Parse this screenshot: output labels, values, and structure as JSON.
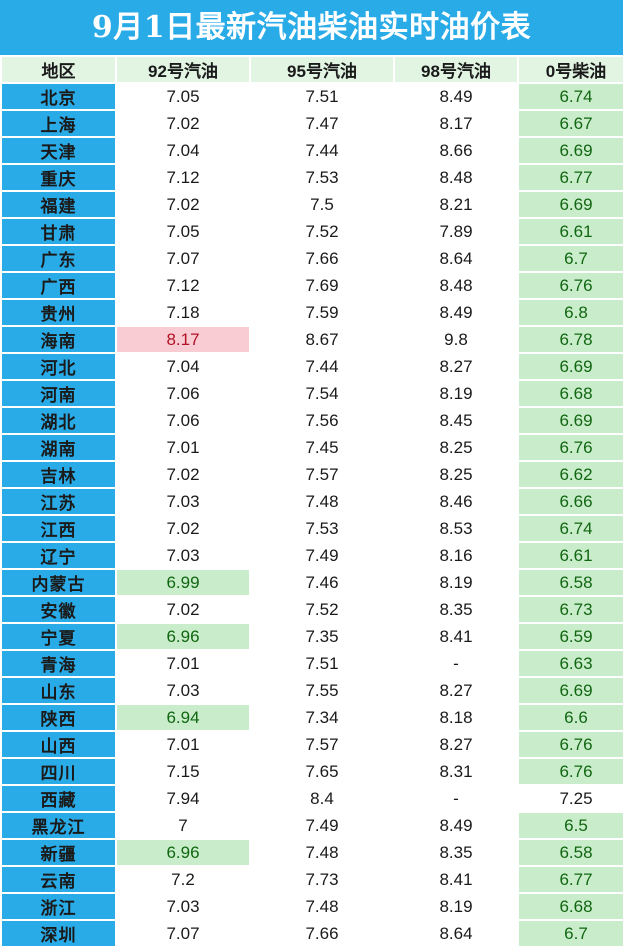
{
  "header": {
    "title": "9月1日最新汽油柴油实时油价表",
    "bar_color": "#29ABE8",
    "title_color": "#ffffff"
  },
  "table": {
    "columns": [
      {
        "key": "region",
        "label": "地区"
      },
      {
        "key": "g92",
        "label": "92号汽油"
      },
      {
        "key": "g95",
        "label": "95号汽油"
      },
      {
        "key": "g98",
        "label": "98号汽油"
      },
      {
        "key": "d0",
        "label": "0号柴油"
      }
    ],
    "colors": {
      "header_bg": "#E2F5E3",
      "region_bg": "#29ABE8",
      "region_text": "#ffffff",
      "cell_bg": "#ffffff",
      "highlight_low_bg": "#C9EDCB",
      "highlight_low_text": "#116611",
      "highlight_high_bg": "#F9CBD2",
      "highlight_high_text": "#B11226"
    },
    "rows": [
      {
        "region": "北京",
        "g92": "7.05",
        "g92_hl": "none",
        "g95": "7.51",
        "g95_hl": "none",
        "g98": "8.49",
        "g98_hl": "none",
        "d0": "6.74",
        "d0_hl": "low"
      },
      {
        "region": "上海",
        "g92": "7.02",
        "g92_hl": "none",
        "g95": "7.47",
        "g95_hl": "none",
        "g98": "8.17",
        "g98_hl": "none",
        "d0": "6.67",
        "d0_hl": "low"
      },
      {
        "region": "天津",
        "g92": "7.04",
        "g92_hl": "none",
        "g95": "7.44",
        "g95_hl": "none",
        "g98": "8.66",
        "g98_hl": "none",
        "d0": "6.69",
        "d0_hl": "low"
      },
      {
        "region": "重庆",
        "g92": "7.12",
        "g92_hl": "none",
        "g95": "7.53",
        "g95_hl": "none",
        "g98": "8.48",
        "g98_hl": "none",
        "d0": "6.77",
        "d0_hl": "low"
      },
      {
        "region": "福建",
        "g92": "7.02",
        "g92_hl": "none",
        "g95": "7.5",
        "g95_hl": "none",
        "g98": "8.21",
        "g98_hl": "none",
        "d0": "6.69",
        "d0_hl": "low"
      },
      {
        "region": "甘肃",
        "g92": "7.05",
        "g92_hl": "none",
        "g95": "7.52",
        "g95_hl": "none",
        "g98": "7.89",
        "g98_hl": "none",
        "d0": "6.61",
        "d0_hl": "low"
      },
      {
        "region": "广东",
        "g92": "7.07",
        "g92_hl": "none",
        "g95": "7.66",
        "g95_hl": "none",
        "g98": "8.64",
        "g98_hl": "none",
        "d0": "6.7",
        "d0_hl": "low"
      },
      {
        "region": "广西",
        "g92": "7.12",
        "g92_hl": "none",
        "g95": "7.69",
        "g95_hl": "none",
        "g98": "8.48",
        "g98_hl": "none",
        "d0": "6.76",
        "d0_hl": "low"
      },
      {
        "region": "贵州",
        "g92": "7.18",
        "g92_hl": "none",
        "g95": "7.59",
        "g95_hl": "none",
        "g98": "8.49",
        "g98_hl": "none",
        "d0": "6.8",
        "d0_hl": "low"
      },
      {
        "region": "海南",
        "g92": "8.17",
        "g92_hl": "high",
        "g95": "8.67",
        "g95_hl": "none",
        "g98": "9.8",
        "g98_hl": "none",
        "d0": "6.78",
        "d0_hl": "low"
      },
      {
        "region": "河北",
        "g92": "7.04",
        "g92_hl": "none",
        "g95": "7.44",
        "g95_hl": "none",
        "g98": "8.27",
        "g98_hl": "none",
        "d0": "6.69",
        "d0_hl": "low"
      },
      {
        "region": "河南",
        "g92": "7.06",
        "g92_hl": "none",
        "g95": "7.54",
        "g95_hl": "none",
        "g98": "8.19",
        "g98_hl": "none",
        "d0": "6.68",
        "d0_hl": "low"
      },
      {
        "region": "湖北",
        "g92": "7.06",
        "g92_hl": "none",
        "g95": "7.56",
        "g95_hl": "none",
        "g98": "8.45",
        "g98_hl": "none",
        "d0": "6.69",
        "d0_hl": "low"
      },
      {
        "region": "湖南",
        "g92": "7.01",
        "g92_hl": "none",
        "g95": "7.45",
        "g95_hl": "none",
        "g98": "8.25",
        "g98_hl": "none",
        "d0": "6.76",
        "d0_hl": "low"
      },
      {
        "region": "吉林",
        "g92": "7.02",
        "g92_hl": "none",
        "g95": "7.57",
        "g95_hl": "none",
        "g98": "8.25",
        "g98_hl": "none",
        "d0": "6.62",
        "d0_hl": "low"
      },
      {
        "region": "江苏",
        "g92": "7.03",
        "g92_hl": "none",
        "g95": "7.48",
        "g95_hl": "none",
        "g98": "8.46",
        "g98_hl": "none",
        "d0": "6.66",
        "d0_hl": "low"
      },
      {
        "region": "江西",
        "g92": "7.02",
        "g92_hl": "none",
        "g95": "7.53",
        "g95_hl": "none",
        "g98": "8.53",
        "g98_hl": "none",
        "d0": "6.74",
        "d0_hl": "low"
      },
      {
        "region": "辽宁",
        "g92": "7.03",
        "g92_hl": "none",
        "g95": "7.49",
        "g95_hl": "none",
        "g98": "8.16",
        "g98_hl": "none",
        "d0": "6.61",
        "d0_hl": "low"
      },
      {
        "region": "内蒙古",
        "g92": "6.99",
        "g92_hl": "low",
        "g95": "7.46",
        "g95_hl": "none",
        "g98": "8.19",
        "g98_hl": "none",
        "d0": "6.58",
        "d0_hl": "low"
      },
      {
        "region": "安徽",
        "g92": "7.02",
        "g92_hl": "none",
        "g95": "7.52",
        "g95_hl": "none",
        "g98": "8.35",
        "g98_hl": "none",
        "d0": "6.73",
        "d0_hl": "low"
      },
      {
        "region": "宁夏",
        "g92": "6.96",
        "g92_hl": "low",
        "g95": "7.35",
        "g95_hl": "none",
        "g98": "8.41",
        "g98_hl": "none",
        "d0": "6.59",
        "d0_hl": "low"
      },
      {
        "region": "青海",
        "g92": "7.01",
        "g92_hl": "none",
        "g95": "7.51",
        "g95_hl": "none",
        "g98": "-",
        "g98_hl": "none",
        "d0": "6.63",
        "d0_hl": "low"
      },
      {
        "region": "山东",
        "g92": "7.03",
        "g92_hl": "none",
        "g95": "7.55",
        "g95_hl": "none",
        "g98": "8.27",
        "g98_hl": "none",
        "d0": "6.69",
        "d0_hl": "low"
      },
      {
        "region": "陕西",
        "g92": "6.94",
        "g92_hl": "low",
        "g95": "7.34",
        "g95_hl": "none",
        "g98": "8.18",
        "g98_hl": "none",
        "d0": "6.6",
        "d0_hl": "low"
      },
      {
        "region": "山西",
        "g92": "7.01",
        "g92_hl": "none",
        "g95": "7.57",
        "g95_hl": "none",
        "g98": "8.27",
        "g98_hl": "none",
        "d0": "6.76",
        "d0_hl": "low"
      },
      {
        "region": "四川",
        "g92": "7.15",
        "g92_hl": "none",
        "g95": "7.65",
        "g95_hl": "none",
        "g98": "8.31",
        "g98_hl": "none",
        "d0": "6.76",
        "d0_hl": "low"
      },
      {
        "region": "西藏",
        "g92": "7.94",
        "g92_hl": "none",
        "g95": "8.4",
        "g95_hl": "none",
        "g98": "-",
        "g98_hl": "none",
        "d0": "7.25",
        "d0_hl": "none"
      },
      {
        "region": "黑龙江",
        "g92": "7",
        "g92_hl": "none",
        "g95": "7.49",
        "g95_hl": "none",
        "g98": "8.49",
        "g98_hl": "none",
        "d0": "6.5",
        "d0_hl": "low"
      },
      {
        "region": "新疆",
        "g92": "6.96",
        "g92_hl": "low",
        "g95": "7.48",
        "g95_hl": "none",
        "g98": "8.35",
        "g98_hl": "none",
        "d0": "6.58",
        "d0_hl": "low"
      },
      {
        "region": "云南",
        "g92": "7.2",
        "g92_hl": "none",
        "g95": "7.73",
        "g95_hl": "none",
        "g98": "8.41",
        "g98_hl": "none",
        "d0": "6.77",
        "d0_hl": "low"
      },
      {
        "region": "浙江",
        "g92": "7.03",
        "g92_hl": "none",
        "g95": "7.48",
        "g95_hl": "none",
        "g98": "8.19",
        "g98_hl": "none",
        "d0": "6.68",
        "d0_hl": "low"
      },
      {
        "region": "深圳",
        "g92": "7.07",
        "g92_hl": "none",
        "g95": "7.66",
        "g95_hl": "none",
        "g98": "8.64",
        "g98_hl": "none",
        "d0": "6.7",
        "d0_hl": "low"
      }
    ]
  }
}
